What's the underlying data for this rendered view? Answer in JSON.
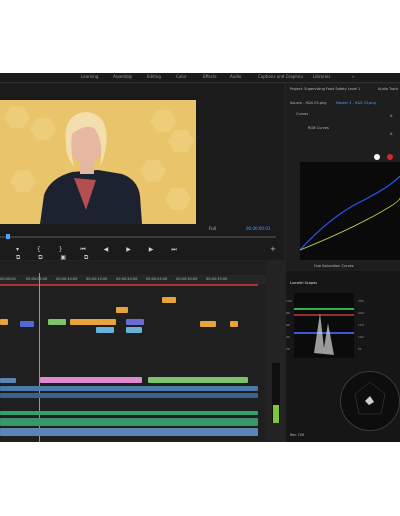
{
  "menu": {
    "tabs": [
      "Learning",
      "Assembly",
      "Editing",
      "Color",
      "Effects",
      "Audio",
      "Captions and Graphics",
      "Libraries"
    ],
    "more": "»"
  },
  "program": {
    "fit": "Full",
    "timecode": "00:00:00:01"
  },
  "timeline": {
    "ruler_labels": [
      "00:00:00",
      "00:00:05:00",
      "00:00:10:00",
      "00:00:15:00",
      "00:00:20:00",
      "00:00:25:00",
      "00:00:30:00",
      "00:00:35:00"
    ]
  },
  "lumetri": {
    "project": "Project: Supervising Food Safety Level 1",
    "audio_track": "Audio Track",
    "source": "Source - H&S 03.png",
    "master": "Master 3 - H&S 03.png",
    "curves": "Curves",
    "rgb_curves": "RGB Curves",
    "hue_label": "Hue Saturation Curves",
    "scopes_title": "Lumetri Scopes",
    "scale_left": [
      "100",
      "80",
      "60",
      "40",
      "20",
      "0"
    ],
    "scale_right": [
      "255",
      "204",
      "153",
      "102",
      "51",
      "0"
    ],
    "footer": "Rec.709",
    "checkbox_label": "A",
    "field": "00:00:01"
  },
  "colors": {
    "accent": "#4aa3ff",
    "background": "#232323",
    "video_bg": "#e9c46a"
  }
}
